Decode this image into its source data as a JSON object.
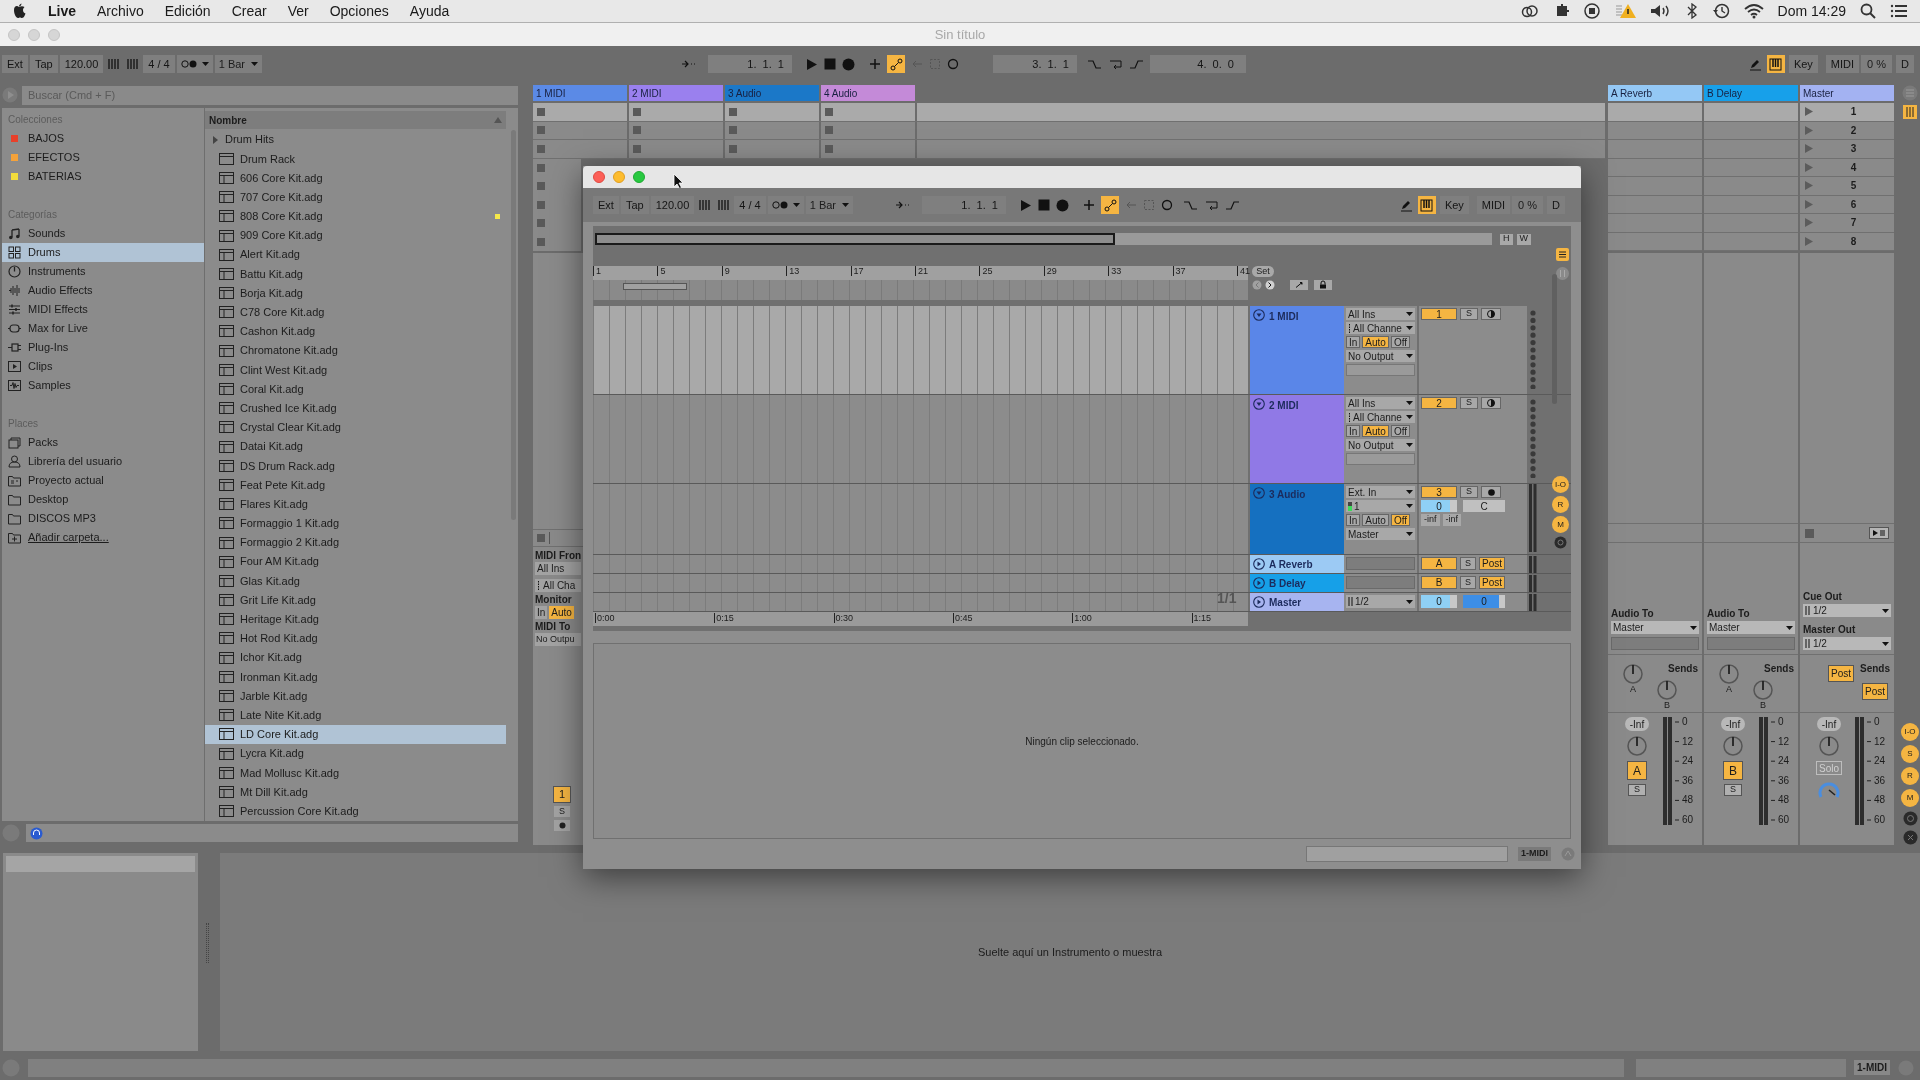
{
  "menu_bar": {
    "app": "Live",
    "items": [
      "Archivo",
      "Edición",
      "Crear",
      "Ver",
      "Opciones",
      "Ayuda"
    ],
    "clock": "Dom 14:29"
  },
  "window": {
    "title": "Sin título"
  },
  "toolbar": {
    "ext": "Ext",
    "tap": "Tap",
    "tempo": "120.00",
    "signature": "4 / 4",
    "quantization": "1 Bar",
    "position": "1.  1.  1",
    "loop_start": "3.  1.  1",
    "loop_length": "4.  0.  0",
    "automation_arm": true,
    "key_map": true,
    "key": "Key",
    "midi": "MIDI",
    "cpu": "0 %",
    "d": "D"
  },
  "browser": {
    "search_placeholder": "Buscar (Cmd + F)",
    "collections_heading": "Colecciones",
    "collections": [
      {
        "label": "BAJOS",
        "color": "#e8402a"
      },
      {
        "label": "EFECTOS",
        "color": "#f5a23a"
      },
      {
        "label": "BATERIAS",
        "color": "#f2dc3c"
      }
    ],
    "categories_heading": "Categorías",
    "categories": [
      {
        "label": "Sounds",
        "kind": "sounds",
        "selected": false
      },
      {
        "label": "Drums",
        "kind": "drums",
        "selected": true
      },
      {
        "label": "Instruments",
        "kind": "instruments",
        "selected": false
      },
      {
        "label": "Audio Effects",
        "kind": "audio_effects",
        "selected": false
      },
      {
        "label": "MIDI Effects",
        "kind": "midi_effects",
        "selected": false
      },
      {
        "label": "Max for Live",
        "kind": "max",
        "selected": false
      },
      {
        "label": "Plug-Ins",
        "kind": "plugins",
        "selected": false
      },
      {
        "label": "Clips",
        "kind": "clips",
        "selected": false
      },
      {
        "label": "Samples",
        "kind": "samples",
        "selected": false
      }
    ],
    "places_heading": "Places",
    "places": [
      {
        "label": "Packs",
        "kind": "packs"
      },
      {
        "label": "Librería del usuario",
        "kind": "user"
      },
      {
        "label": "Proyecto actual",
        "kind": "project"
      },
      {
        "label": "Desktop",
        "kind": "folder"
      },
      {
        "label": "DISCOS MP3",
        "kind": "folder"
      },
      {
        "label": "Añadir carpeta...",
        "kind": "add"
      }
    ],
    "column_heading": "Nombre",
    "files": [
      {
        "label": "Drum Hits",
        "kind": "folder",
        "selected": false,
        "marked": false
      },
      {
        "label": "Drum Rack",
        "kind": "device",
        "selected": false,
        "marked": false
      },
      {
        "label": "606 Core Kit.adg",
        "kind": "preset",
        "selected": false,
        "marked": false
      },
      {
        "label": "707 Core Kit.adg",
        "kind": "preset",
        "selected": false,
        "marked": false
      },
      {
        "label": "808 Core Kit.adg",
        "kind": "preset",
        "selected": false,
        "marked": true
      },
      {
        "label": "909 Core Kit.adg",
        "kind": "preset",
        "selected": false,
        "marked": false
      },
      {
        "label": "Alert Kit.adg",
        "kind": "preset",
        "selected": false,
        "marked": false
      },
      {
        "label": "Battu Kit.adg",
        "kind": "preset",
        "selected": false,
        "marked": false
      },
      {
        "label": "Borja Kit.adg",
        "kind": "preset",
        "selected": false,
        "marked": false
      },
      {
        "label": "C78 Core Kit.adg",
        "kind": "preset",
        "selected": false,
        "marked": false
      },
      {
        "label": "Cashon Kit.adg",
        "kind": "preset",
        "selected": false,
        "marked": false
      },
      {
        "label": "Chromatone Kit.adg",
        "kind": "preset",
        "selected": false,
        "marked": false
      },
      {
        "label": "Clint West Kit.adg",
        "kind": "preset",
        "selected": false,
        "marked": false
      },
      {
        "label": "Coral Kit.adg",
        "kind": "preset",
        "selected": false,
        "marked": false
      },
      {
        "label": "Crushed Ice Kit.adg",
        "kind": "preset",
        "selected": false,
        "marked": false
      },
      {
        "label": "Crystal Clear Kit.adg",
        "kind": "preset",
        "selected": false,
        "marked": false
      },
      {
        "label": "Datai Kit.adg",
        "kind": "preset",
        "selected": false,
        "marked": false
      },
      {
        "label": "DS Drum Rack.adg",
        "kind": "preset",
        "selected": false,
        "marked": false
      },
      {
        "label": "Feat Pete Kit.adg",
        "kind": "preset",
        "selected": false,
        "marked": false
      },
      {
        "label": "Flares Kit.adg",
        "kind": "preset",
        "selected": false,
        "marked": false
      },
      {
        "label": "Formaggio 1 Kit.adg",
        "kind": "preset",
        "selected": false,
        "marked": false
      },
      {
        "label": "Formaggio 2 Kit.adg",
        "kind": "preset",
        "selected": false,
        "marked": false
      },
      {
        "label": "Four AM Kit.adg",
        "kind": "preset",
        "selected": false,
        "marked": false
      },
      {
        "label": "Glas Kit.adg",
        "kind": "preset",
        "selected": false,
        "marked": false
      },
      {
        "label": "Grit Life Kit.adg",
        "kind": "preset",
        "selected": false,
        "marked": false
      },
      {
        "label": "Heritage Kit.adg",
        "kind": "preset",
        "selected": false,
        "marked": false
      },
      {
        "label": "Hot Rod Kit.adg",
        "kind": "preset",
        "selected": false,
        "marked": false
      },
      {
        "label": "Ichor Kit.adg",
        "kind": "preset",
        "selected": false,
        "marked": false
      },
      {
        "label": "Ironman Kit.adg",
        "kind": "preset",
        "selected": false,
        "marked": false
      },
      {
        "label": "Jarble Kit.adg",
        "kind": "preset",
        "selected": false,
        "marked": false
      },
      {
        "label": "Late Nite Kit.adg",
        "kind": "preset",
        "selected": false,
        "marked": false
      },
      {
        "label": "LD Core Kit.adg",
        "kind": "preset",
        "selected": true,
        "marked": false
      },
      {
        "label": "Lycra Kit.adg",
        "kind": "preset",
        "selected": false,
        "marked": false
      },
      {
        "label": "Mad Mollusc Kit.adg",
        "kind": "preset",
        "selected": false,
        "marked": false
      },
      {
        "label": "Mt Dill Kit.adg",
        "kind": "preset",
        "selected": false,
        "marked": false
      },
      {
        "label": "Percussion Core Kit.adg",
        "kind": "preset",
        "selected": false,
        "marked": false
      }
    ]
  },
  "session": {
    "tracks": [
      {
        "name": "1 MIDI",
        "color": "#5b8ae6"
      },
      {
        "name": "2 MIDI",
        "color": "#9a80ee"
      },
      {
        "name": "3 Audio",
        "color": "#1b78c8"
      },
      {
        "name": "4 Audio",
        "color": "#c48ad8"
      }
    ],
    "track_io": {
      "midi_from": "MIDI Fron",
      "input": "All Ins",
      "channel": "All Cha",
      "monitor_label": "Monitor",
      "monitor": [
        {
          "label": "In",
          "selected": false
        },
        {
          "label": "Auto",
          "selected": true
        }
      ],
      "midi_to": "MIDI To",
      "output": "No Outpu",
      "activator": "1",
      "solo": "S"
    },
    "returns": [
      {
        "name": "A Reverb",
        "color": "#94c8f5",
        "audio_to_label": "Audio To",
        "audio_to": "Master",
        "sends_label": "Sends",
        "send_labels": [
          "A",
          "B"
        ],
        "volume": "-Inf",
        "meter_scale": [
          "0",
          "12",
          "24",
          "36",
          "48",
          "60"
        ],
        "activator": "A",
        "solo": "S"
      },
      {
        "name": "B Delay",
        "color": "#17a0ea",
        "audio_to_label": "Audio To",
        "audio_to": "Master",
        "sends_label": "Sends",
        "send_labels": [
          "A",
          "B"
        ],
        "volume": "-Inf",
        "meter_scale": [
          "0",
          "12",
          "24",
          "36",
          "48",
          "60"
        ],
        "activator": "B",
        "solo": "S"
      }
    ],
    "master": {
      "name": "Master",
      "color": "#a3b2f2",
      "scenes": [
        "1",
        "2",
        "3",
        "4",
        "5",
        "6",
        "7",
        "8"
      ],
      "cue_out_label": "Cue Out",
      "cue_out": "1/2",
      "master_out_label": "Master Out",
      "master_out": "1/2",
      "sends_label": "Sends",
      "post": [
        "Post",
        "Post"
      ],
      "volume": "-Inf",
      "meter_scale": [
        "0",
        "12",
        "24",
        "36",
        "48",
        "60"
      ],
      "solo": "Solo"
    },
    "view_toggles": [
      "I-O",
      "S",
      "R",
      "M"
    ]
  },
  "arrangement_window": {
    "toolbar": {
      "ext": "Ext",
      "tap": "Tap",
      "tempo": "120.00",
      "signature": "4 / 4",
      "quantization": "1 Bar",
      "position": "1.  1.  1",
      "automation_arm": true,
      "key_map": true,
      "key": "Key",
      "midi": "MIDI",
      "cpu": "0 %",
      "d": "D"
    },
    "overview_buttons": [
      "H",
      "W"
    ],
    "ruler": [
      "1",
      "5",
      "9",
      "13",
      "17",
      "21",
      "25",
      "29",
      "33",
      "37",
      "41"
    ],
    "set_label": "Set",
    "tracks": [
      {
        "name": "1 MIDI",
        "kind": "midi",
        "color": "#5a86e8",
        "selected": true,
        "input": "All Ins",
        "channel": "All Channe",
        "monitor": [
          {
            "label": "In",
            "selected": false
          },
          {
            "label": "Auto",
            "selected": true
          },
          {
            "label": "Off",
            "selected": false
          }
        ],
        "output": "No Output",
        "activator": "1",
        "solo": "S"
      },
      {
        "name": "2 MIDI",
        "kind": "midi",
        "color": "#9079e6",
        "selected": false,
        "input": "All Ins",
        "channel": "All Channe",
        "monitor": [
          {
            "label": "In",
            "selected": false
          },
          {
            "label": "Auto",
            "selected": true
          },
          {
            "label": "Off",
            "selected": false
          }
        ],
        "output": "No Output",
        "activator": "2",
        "solo": "S"
      },
      {
        "name": "3 Audio",
        "kind": "audio",
        "color": "#1570c0",
        "selected": false,
        "input": "Ext. In",
        "channel": "1",
        "monitor": [
          {
            "label": "In",
            "selected": false
          },
          {
            "label": "Auto",
            "selected": false
          },
          {
            "label": "Off",
            "selected": true
          }
        ],
        "output": "Master",
        "activator": "3",
        "solo": "S",
        "volume": "0",
        "pan": "C",
        "meters": [
          "-inf",
          "-inf"
        ]
      }
    ],
    "returns": [
      {
        "name": "A Reverb",
        "color": "#9ccaf4",
        "activator": "A",
        "solo": "S",
        "post": "Post"
      },
      {
        "name": "B Delay",
        "color": "#16a0e8",
        "activator": "B",
        "solo": "S",
        "post": "Post"
      }
    ],
    "master": {
      "name": "Master",
      "color": "#a7b4f0",
      "output": "1/2",
      "volume": "0",
      "cue_volume": "0"
    },
    "zoom_label": "1/1",
    "time_ruler": [
      "0:00",
      "0:15",
      "0:30",
      "0:45",
      "1:00",
      "1:15"
    ],
    "detail_message": "Ningún clip seleccionado.",
    "status": "1-MIDI",
    "view_toggles": [
      "I-O",
      "R",
      "M"
    ]
  },
  "detail": {
    "message": "Suelte aquí un Instrumento o muestra"
  },
  "status_bar": {
    "track": "1-MIDI"
  }
}
